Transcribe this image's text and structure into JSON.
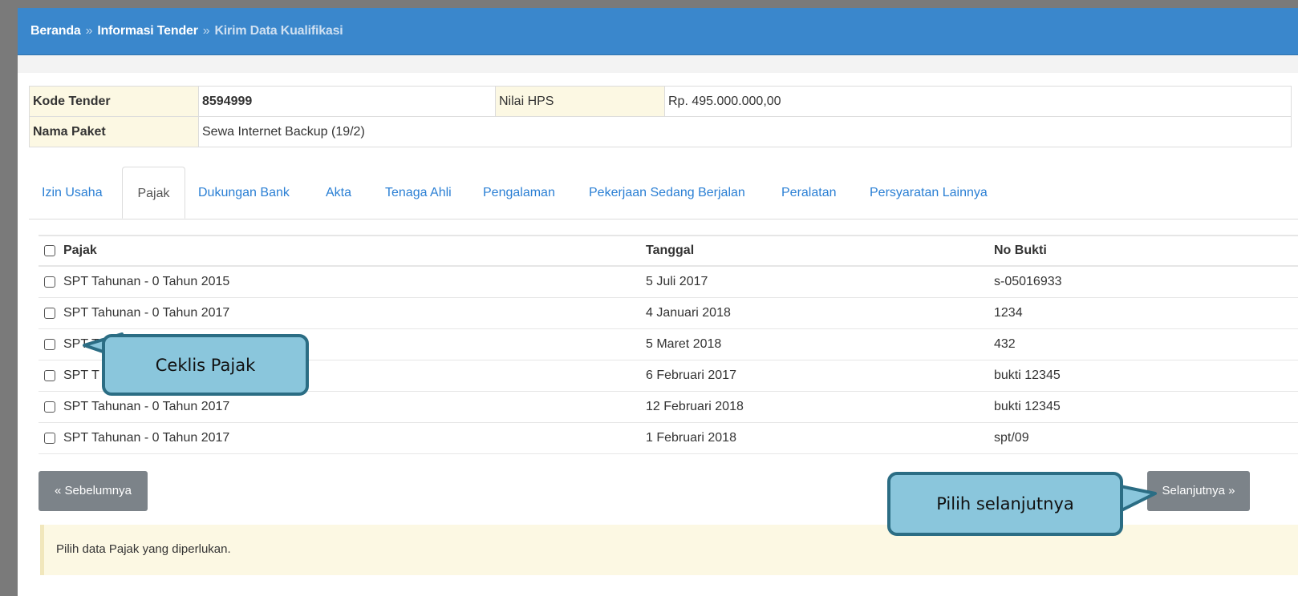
{
  "breadcrumb": {
    "items": [
      "Beranda",
      "Informasi Tender",
      "Kirim Data Kualifikasi"
    ],
    "separator": "»"
  },
  "info": {
    "kode_tender_label": "Kode Tender",
    "kode_tender_value": "8594999",
    "nilai_hps_label": "Nilai HPS",
    "nilai_hps_value": "Rp. 495.000.000,00",
    "nama_paket_label": "Nama Paket",
    "nama_paket_value": "Sewa Internet Backup (19/2)"
  },
  "tabs": [
    {
      "label": "Izin Usaha",
      "active": false
    },
    {
      "label": "Pajak",
      "active": true
    },
    {
      "label": "Dukungan Bank",
      "active": false
    },
    {
      "label": "Akta",
      "active": false
    },
    {
      "label": "Tenaga Ahli",
      "active": false
    },
    {
      "label": "Pengalaman",
      "active": false
    },
    {
      "label": "Pekerjaan Sedang Berjalan",
      "active": false
    },
    {
      "label": "Peralatan",
      "active": false
    },
    {
      "label": "Persyaratan Lainnya",
      "active": false
    }
  ],
  "table": {
    "headers": [
      "Pajak",
      "Tanggal",
      "No Bukti"
    ],
    "rows": [
      {
        "pajak": "SPT Tahunan - 0 Tahun 2015",
        "tanggal": "5 Juli 2017",
        "no_bukti": "s-05016933"
      },
      {
        "pajak": "SPT Tahunan - 0 Tahun 2017",
        "tanggal": "4 Januari 2018",
        "no_bukti": "1234"
      },
      {
        "pajak": "SPT T",
        "tanggal": "5 Maret 2018",
        "no_bukti": "432"
      },
      {
        "pajak": "SPT T",
        "tanggal": "6 Februari 2017",
        "no_bukti": "bukti 12345"
      },
      {
        "pajak": "SPT Tahunan - 0 Tahun 2017",
        "tanggal": "12 Februari 2018",
        "no_bukti": "bukti 12345"
      },
      {
        "pajak": "SPT Tahunan - 0 Tahun 2017",
        "tanggal": "1 Februari 2018",
        "no_bukti": "spt/09"
      }
    ]
  },
  "buttons": {
    "prev": "« Sebelumnya",
    "next": "Selanjutnya »"
  },
  "notice": "Pilih data Pajak yang diperlukan.",
  "callouts": {
    "ceklis": "Ceklis Pajak",
    "selanjutnya": "Pilih selanjutnya"
  },
  "colors": {
    "header_bg": "#3a87cc",
    "label_bg": "#fcf8e3",
    "link": "#2a7fd4",
    "button_bg": "#7c8389",
    "callout_fill": "#8ac6dc",
    "callout_border": "#2b6d84"
  }
}
